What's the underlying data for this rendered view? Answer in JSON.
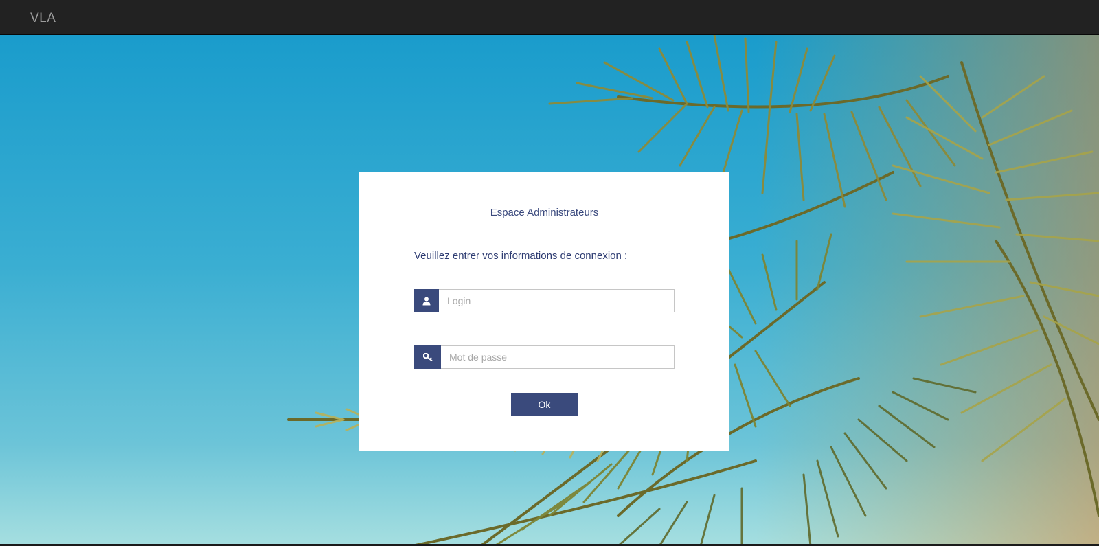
{
  "navbar": {
    "brand": "VLA",
    "background_color": "#222222"
  },
  "background": {
    "description_icon": "palm-tree-photo",
    "sky_color": "#1a9ccc"
  },
  "login_card": {
    "title": "Espace Administrateurs",
    "instructions": "Veuillez entrer vos informations de connexion :",
    "login_field": {
      "icon": "user-icon",
      "value": "",
      "placeholder": "Login"
    },
    "password_field": {
      "icon": "key-icon",
      "value": "",
      "placeholder": "Mot de passe"
    },
    "submit_label": "Ok",
    "accent_color": "#3a4a7c"
  }
}
